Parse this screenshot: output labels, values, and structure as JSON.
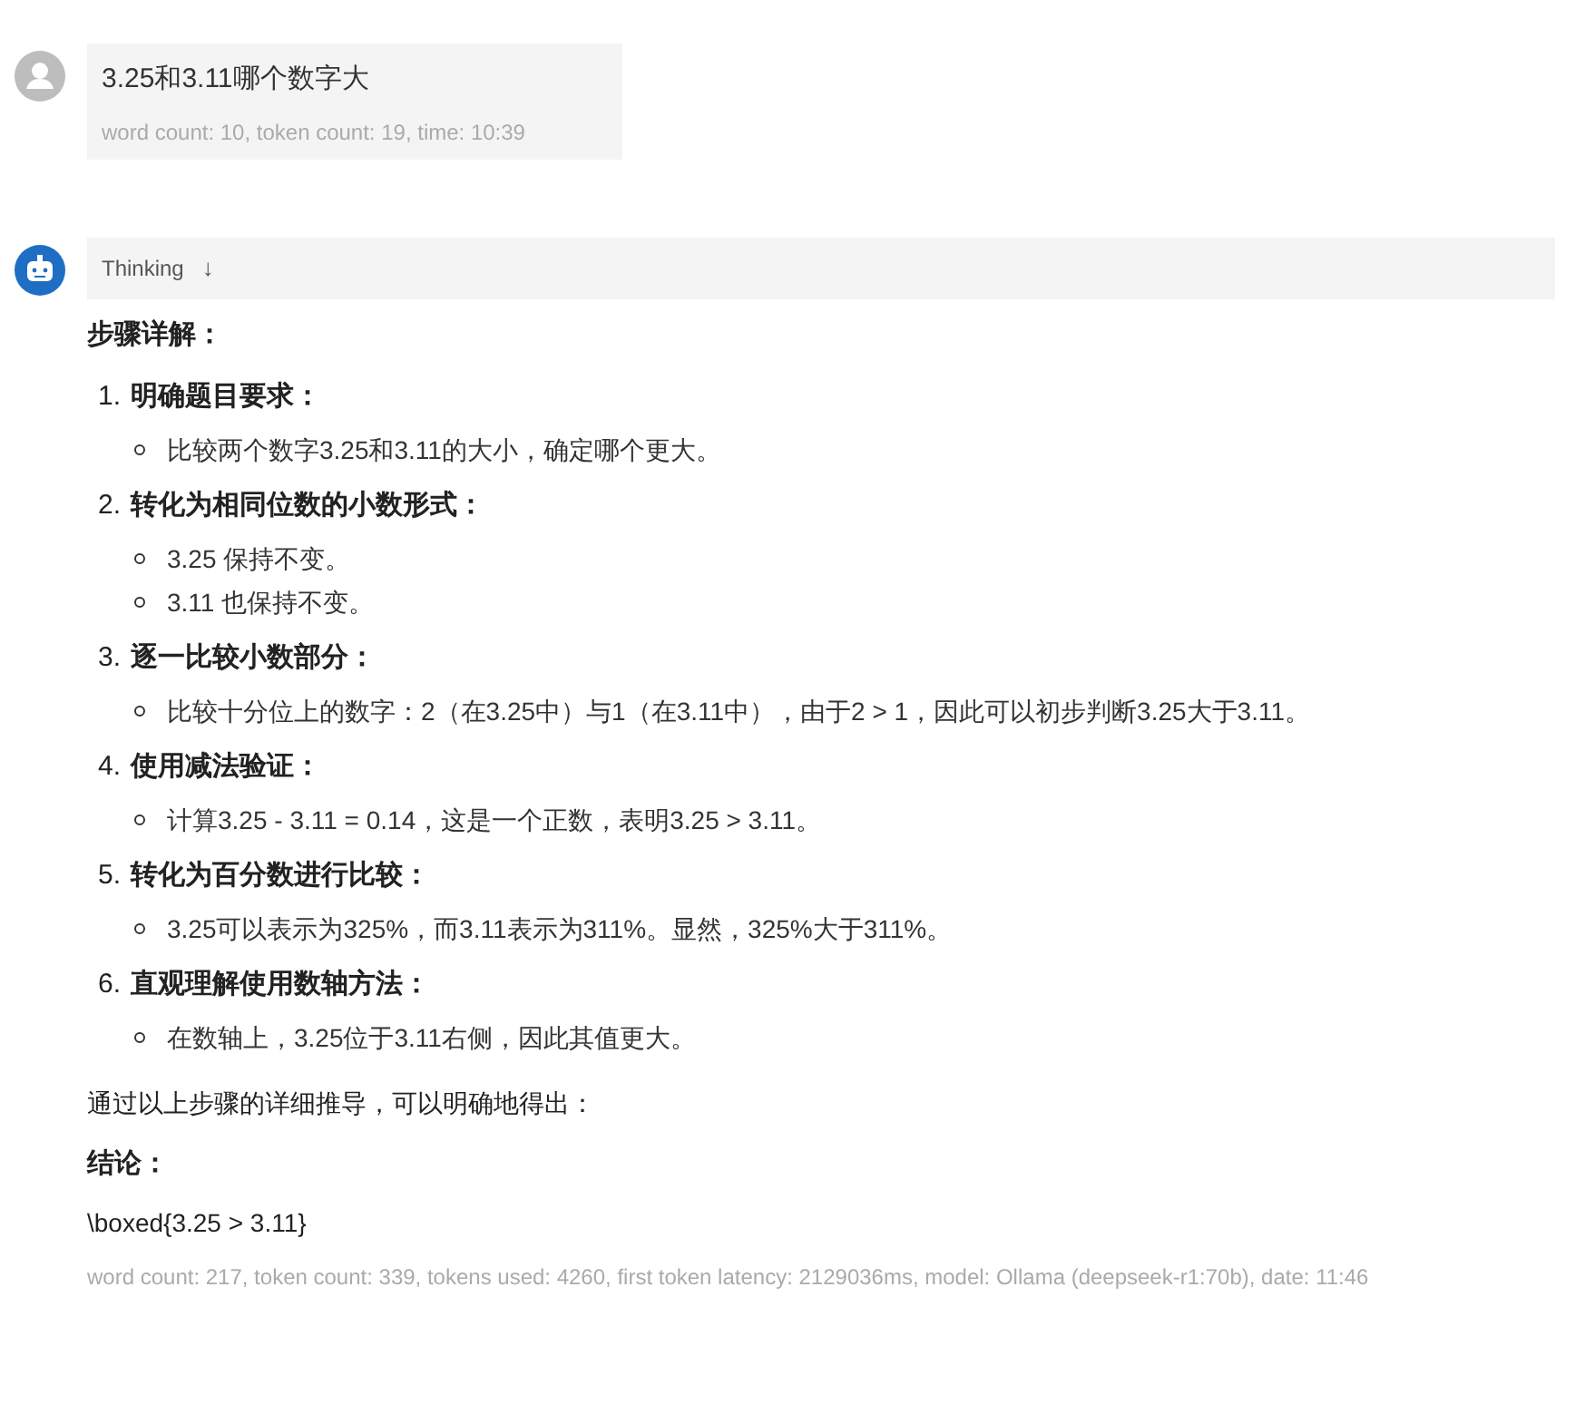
{
  "user_message": {
    "text": "3.25和3.11哪个数字大",
    "meta": "word count: 10, token count: 19, time: 10:39"
  },
  "assistant_message": {
    "thinking": {
      "label": "Thinking",
      "arrow": "↓"
    },
    "heading": "步骤详解：",
    "steps": [
      {
        "number": "1.",
        "title": "明确题目要求：",
        "points": [
          "比较两个数字3.25和3.11的大小，确定哪个更大。"
        ]
      },
      {
        "number": "2.",
        "title": "转化为相同位数的小数形式：",
        "points": [
          "3.25 保持不变。",
          "3.11 也保持不变。"
        ]
      },
      {
        "number": "3.",
        "title": "逐一比较小数部分：",
        "points": [
          "比较十分位上的数字：2（在3.25中）与1（在3.11中），由于2 > 1，因此可以初步判断3.25大于3.11。"
        ]
      },
      {
        "number": "4.",
        "title": "使用减法验证：",
        "points": [
          "计算3.25 - 3.11 = 0.14，这是一个正数，表明3.25 > 3.11。"
        ]
      },
      {
        "number": "5.",
        "title": "转化为百分数进行比较：",
        "points": [
          "3.25可以表示为325%，而3.11表示为311%。显然，325%大于311%。"
        ]
      },
      {
        "number": "6.",
        "title": "直观理解使用数轴方法：",
        "points": [
          "在数轴上，3.25位于3.11右侧，因此其值更大。"
        ]
      }
    ],
    "summary": "通过以上步骤的详细推导，可以明确地得出：",
    "conclusion_label": "结论：",
    "answer": "\\boxed{3.25 > 3.11}",
    "meta": "word count: 217, token count: 339, tokens used: 4260, first token latency: 2129036ms, model: Ollama (deepseek-r1:70b), date: 11:46"
  }
}
